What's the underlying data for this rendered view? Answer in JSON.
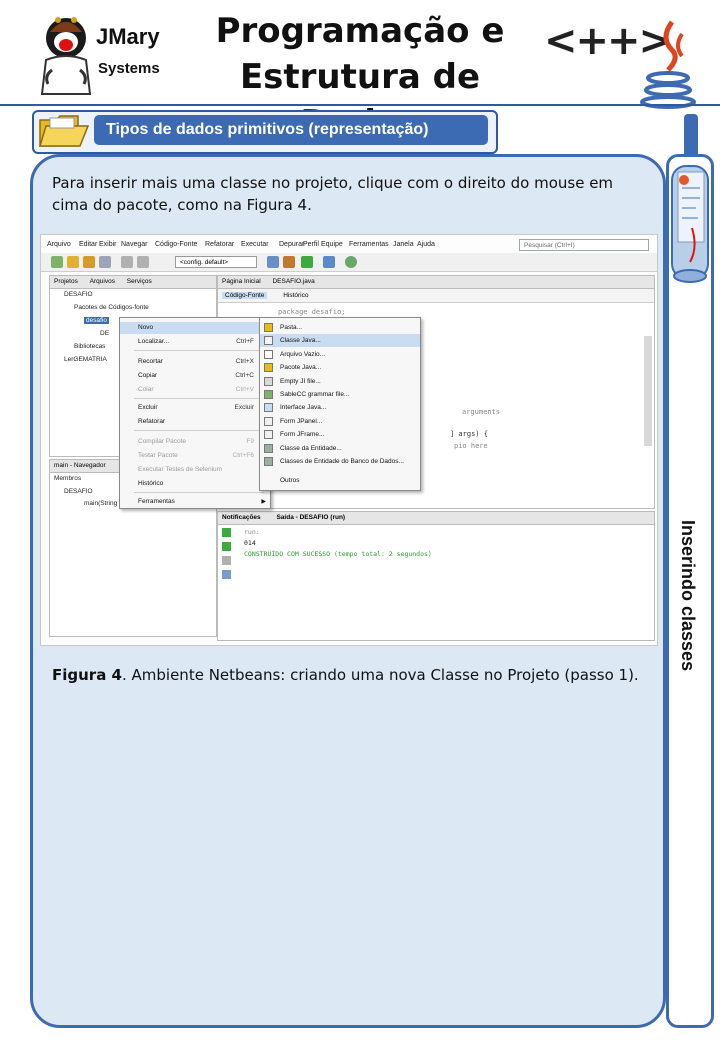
{
  "header": {
    "logo_name": "JMary",
    "logo_sub": "Systems",
    "title_line1": "Programação e",
    "title_line2": "Estrutura de Dados",
    "cpp_logo": "<++>"
  },
  "topic": {
    "label": "Tipos de dados primitivos (representação)"
  },
  "content": {
    "intro": "Para inserir mais uma classe no projeto, clique com o direito do mouse em cima do pacote, como na Figura 4.",
    "caption_bold": "Figura 4",
    "caption_rest": ". Ambiente Netbeans: criando uma nova Classe no Projeto (passo 1)."
  },
  "side_tab": {
    "label": "Inserindo classes"
  },
  "screenshot": {
    "menubar": [
      "Arquivo",
      "Editar",
      "Exibir",
      "Navegar",
      "Código-Fonte",
      "Refatorar",
      "Executar",
      "Depurar",
      "Perfil",
      "Equipe",
      "Ferramentas",
      "Janela",
      "Ajuda"
    ],
    "search_placeholder": "Pesquisar (Ctrl+I)",
    "config": "<config. default>",
    "project_tabs": [
      "Projetos",
      "Arquivos",
      "Serviços"
    ],
    "tree": [
      "DESAFIO",
      "Pacotes de Códigos-fonte",
      "desafio",
      "DE",
      "Bibliotecas",
      "LerGEMATRIA"
    ],
    "navigator_tabs": [
      "main - Navegador",
      "Membros"
    ],
    "navigator_tree": [
      "DESAFIO",
      "main(String"
    ],
    "editor_tabs": [
      "Página Inicial",
      "DESAFIO.java"
    ],
    "editor_sub": [
      "Código-Fonte",
      "Histórico"
    ],
    "code_lines": [
      "package desafio;",
      "arguments",
      "] args) {",
      "pio here"
    ],
    "output_tabs": [
      "Notificações",
      "Saída - DESAFIO (run)"
    ],
    "output_lines": [
      "run:",
      "014",
      "CONSTRUÍDO COM SUCESSO (tempo total: 2 segundos)"
    ],
    "context_menu": [
      {
        "label": "Novo",
        "shortcut": "",
        "dim": false,
        "hl": true,
        "arrow": true
      },
      {
        "label": "Localizar...",
        "shortcut": "Ctrl+F",
        "dim": false,
        "hl": false,
        "arrow": false
      },
      {
        "label": "Recortar",
        "shortcut": "Ctrl+X",
        "dim": false,
        "hl": false,
        "arrow": false
      },
      {
        "label": "Copiar",
        "shortcut": "Ctrl+C",
        "dim": false,
        "hl": false,
        "arrow": false
      },
      {
        "label": "Colar",
        "shortcut": "Ctrl+V",
        "dim": true,
        "hl": false,
        "arrow": false
      },
      {
        "label": "Excluir",
        "shortcut": "Excluir",
        "dim": false,
        "hl": false,
        "arrow": false
      },
      {
        "label": "Refatorar",
        "shortcut": "",
        "dim": false,
        "hl": false,
        "arrow": true
      },
      {
        "label": "Compilar Pacote",
        "shortcut": "F9",
        "dim": true,
        "hl": false,
        "arrow": false
      },
      {
        "label": "Testar Pacote",
        "shortcut": "Ctrl+F6",
        "dim": true,
        "hl": false,
        "arrow": false
      },
      {
        "label": "Executar Testes de Selenium",
        "shortcut": "",
        "dim": true,
        "hl": false,
        "arrow": false
      },
      {
        "label": "Histórico",
        "shortcut": "",
        "dim": false,
        "hl": false,
        "arrow": true
      },
      {
        "label": "Ferramentas",
        "shortcut": "",
        "dim": false,
        "hl": false,
        "arrow": true
      }
    ],
    "submenu": [
      "Pasta...",
      "Classe Java...",
      "Arquivo Vazio...",
      "Pacote Java...",
      "Empty JI file...",
      "SableCC grammar file...",
      "Interface Java...",
      "Form JPanel...",
      "Form JFrame...",
      "Classe da Entidade...",
      "Classes de Entidade do Banco de Dados...",
      "Outros"
    ],
    "submenu_highlight": "Classe Java..."
  },
  "colors": {
    "accent": "#3d6bb3",
    "panel_bg": "#dce9f4",
    "highlight": "#c9dcf2"
  }
}
